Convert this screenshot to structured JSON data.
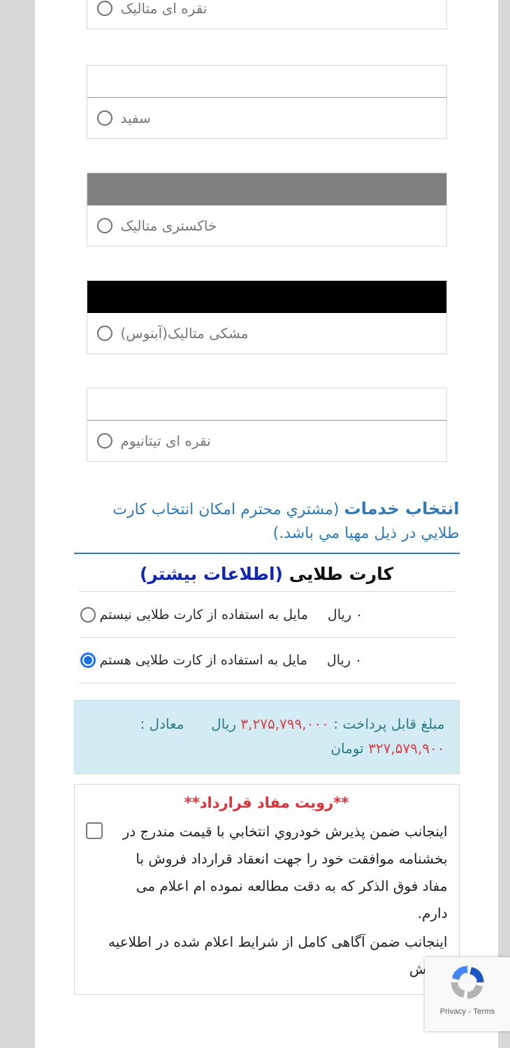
{
  "colors": {
    "options": [
      {
        "label": "نقره ای متالیک",
        "swatch_hex": "#ffffff",
        "has_swatch": false,
        "selected": false
      },
      {
        "label": "سفید",
        "swatch_hex": "#ffffff",
        "has_swatch": true,
        "selected": false
      },
      {
        "label": "خاکستری متالیک",
        "swatch_hex": "#808080",
        "has_swatch": true,
        "selected": false
      },
      {
        "label": "مشکی متالیک(آبنوس)",
        "swatch_hex": "#000000",
        "has_swatch": true,
        "selected": false
      },
      {
        "label": "نقره ای تیتانیوم",
        "swatch_hex": "#ffffff",
        "has_swatch": true,
        "selected": false
      }
    ]
  },
  "services": {
    "heading_strong": "انتخاب خدمات",
    "heading_note": "(مشتري محترم امکان انتخاب کارت طلايي در ذیل مهیا مي باشد.)",
    "accent_hex": "#2e7ab8"
  },
  "gold_card": {
    "title_black": "کارت طلایی",
    "title_blue": "(اطلاعات بیشتر)",
    "title_blue_hex": "#1126b5",
    "rows": [
      {
        "label": "مایل به استفاده از کارت طلایی نیستم",
        "price": "۰ ریال",
        "selected": false
      },
      {
        "label": "مایل به استفاده از کارت طلایی هستم",
        "price": "۰ ریال",
        "selected": true
      }
    ]
  },
  "amount": {
    "payable_label": "مبلغ قابل پرداخت :",
    "payable_value": "۳,۲۷۵,۷۹۹,۰۰۰",
    "payable_currency": "ریال",
    "equivalent_label": "معادل :",
    "equivalent_value": "۳۲۷,۵۷۹,۹۰۰",
    "equivalent_currency": "تومان",
    "bg_hex": "#d3ecf3",
    "text_hex": "#2c7a8c",
    "number_hex": "#d9424a"
  },
  "contract": {
    "title": "**رویت مفاد قرارداد**",
    "accept_text": "اینجانب ضمن پذیرش خودروي انتخابي با قیمت مندرج در بخشنامه موافقت خود را جهت انعقاد قرارداد فروش با مفاد فوق الذکر که به دقت مطالعه نموده ام اعلام می دارم.",
    "next_line": "اینجانب ضمن آگاهی کامل از شرایط اعلام شده در اطلاعیه فروش",
    "title_hex": "#d9343a",
    "checked": false
  },
  "recaptcha": {
    "privacy": "Privacy",
    "separator": "-",
    "terms": "Terms",
    "icon": "recaptcha-logo-icon"
  }
}
